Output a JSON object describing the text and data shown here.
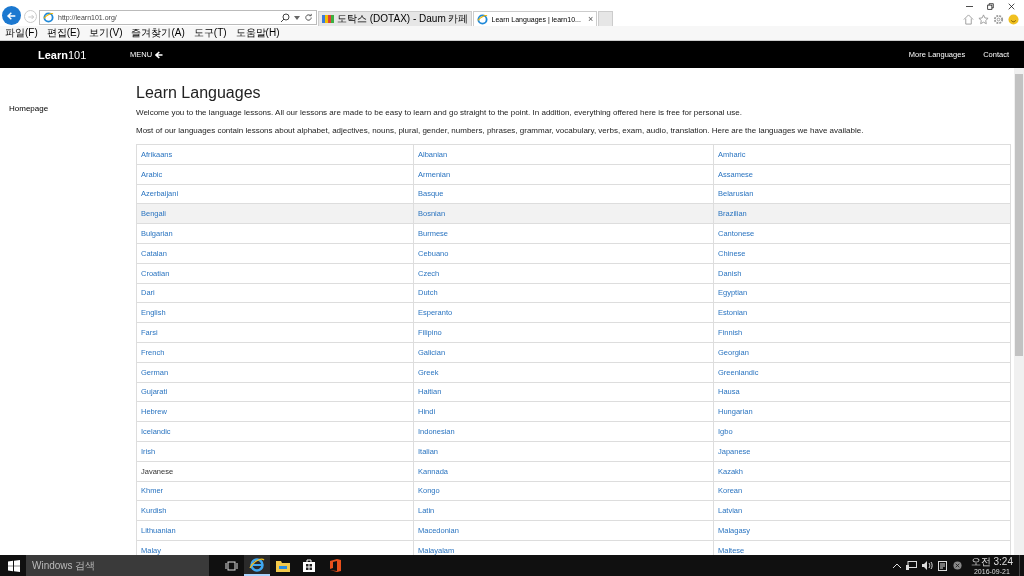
{
  "browser": {
    "url": "http://learn101.org/",
    "tabs": [
      {
        "title": "도탁스 (DOTAX) - Daum 카페",
        "selected": false
      },
      {
        "title": "Learn Languages | learn10...",
        "selected": true,
        "close": "×"
      }
    ],
    "menu": [
      "파일(F)",
      "편집(E)",
      "보기(V)",
      "즐겨찾기(A)",
      "도구(T)",
      "도움말(H)"
    ]
  },
  "header": {
    "logo": "**Learn**101",
    "menu": "MENU",
    "nav": [
      "More Languages",
      "Contact"
    ]
  },
  "sidebar": {
    "items": [
      "Homepage"
    ]
  },
  "page": {
    "title": "Learn Languages",
    "paragraphs": [
      "Welcome you to the language lessons. All our lessons are made to be easy to learn and go straight to the point. In addition, everything offered here is free for personal use.",
      "Most of our languages contain lessons about alphabet, adjectives, nouns, plural, gender, numbers, phrases, grammar, vocabulary, verbs, exam, audio, translation. Here are the languages we have available."
    ]
  },
  "table": {
    "rows": [
      {
        "highlighted": false,
        "cells": [
          {
            "text": "Afrikaans",
            "link": true
          },
          {
            "text": "Albanian",
            "link": true
          },
          {
            "text": "Amharic",
            "link": true
          }
        ]
      },
      {
        "highlighted": false,
        "cells": [
          {
            "text": "Arabic",
            "link": true
          },
          {
            "text": "Armenian",
            "link": true
          },
          {
            "text": "Assamese",
            "link": true
          }
        ]
      },
      {
        "highlighted": false,
        "cells": [
          {
            "text": "Azerbaijani",
            "link": true
          },
          {
            "text": "Basque",
            "link": true
          },
          {
            "text": "Belarusian",
            "link": true
          }
        ]
      },
      {
        "highlighted": true,
        "cells": [
          {
            "text": "Bengali",
            "link": true
          },
          {
            "text": "Bosnian",
            "link": true
          },
          {
            "text": "Brazilian",
            "link": true
          }
        ]
      },
      {
        "highlighted": false,
        "cells": [
          {
            "text": "Bulgarian",
            "link": true
          },
          {
            "text": "Burmese",
            "link": true
          },
          {
            "text": "Cantonese",
            "link": true
          }
        ]
      },
      {
        "highlighted": false,
        "cells": [
          {
            "text": "Catalan",
            "link": true
          },
          {
            "text": "Cebuano",
            "link": true
          },
          {
            "text": "Chinese",
            "link": true
          }
        ]
      },
      {
        "highlighted": false,
        "cells": [
          {
            "text": "Croatian",
            "link": true
          },
          {
            "text": "Czech",
            "link": true
          },
          {
            "text": "Danish",
            "link": true
          }
        ]
      },
      {
        "highlighted": false,
        "cells": [
          {
            "text": "Dari",
            "link": true
          },
          {
            "text": "Dutch",
            "link": true
          },
          {
            "text": "Egyptian",
            "link": true
          }
        ]
      },
      {
        "highlighted": false,
        "cells": [
          {
            "text": "English",
            "link": true
          },
          {
            "text": "Esperanto",
            "link": true
          },
          {
            "text": "Estonian",
            "link": true
          }
        ]
      },
      {
        "highlighted": false,
        "cells": [
          {
            "text": "Farsi",
            "link": true
          },
          {
            "text": "Filipino",
            "link": true
          },
          {
            "text": "Finnish",
            "link": true
          }
        ]
      },
      {
        "highlighted": false,
        "cells": [
          {
            "text": "French",
            "link": true
          },
          {
            "text": "Galician",
            "link": true
          },
          {
            "text": "Georgian",
            "link": true
          }
        ]
      },
      {
        "highlighted": false,
        "cells": [
          {
            "text": "German",
            "link": true
          },
          {
            "text": "Greek",
            "link": true
          },
          {
            "text": "Greenlandic",
            "link": true
          }
        ]
      },
      {
        "highlighted": false,
        "cells": [
          {
            "text": "Gujarati",
            "link": true
          },
          {
            "text": "Haitian",
            "link": true
          },
          {
            "text": "Hausa",
            "link": true
          }
        ]
      },
      {
        "highlighted": false,
        "cells": [
          {
            "text": "Hebrew",
            "link": true
          },
          {
            "text": "Hindi",
            "link": true
          },
          {
            "text": "Hungarian",
            "link": true
          }
        ]
      },
      {
        "highlighted": false,
        "cells": [
          {
            "text": "Icelandic",
            "link": true
          },
          {
            "text": "Indonesian",
            "link": true
          },
          {
            "text": "Igbo",
            "link": true
          }
        ]
      },
      {
        "highlighted": false,
        "cells": [
          {
            "text": "Irish",
            "link": true
          },
          {
            "text": "Italian",
            "link": true
          },
          {
            "text": "Japanese",
            "link": true
          }
        ]
      },
      {
        "highlighted": false,
        "cells": [
          {
            "text": "Javanese",
            "link": false
          },
          {
            "text": "Kannada",
            "link": true
          },
          {
            "text": "Kazakh",
            "link": true
          }
        ]
      },
      {
        "highlighted": false,
        "cells": [
          {
            "text": "Khmer",
            "link": true
          },
          {
            "text": "Kongo",
            "link": true
          },
          {
            "text": "Korean",
            "link": true
          }
        ]
      },
      {
        "highlighted": false,
        "cells": [
          {
            "text": "Kurdish",
            "link": true
          },
          {
            "text": "Latin",
            "link": true
          },
          {
            "text": "Latvian",
            "link": true
          }
        ]
      },
      {
        "highlighted": false,
        "cells": [
          {
            "text": "Lithuanian",
            "link": true
          },
          {
            "text": "Macedonian",
            "link": true
          },
          {
            "text": "Malagasy",
            "link": true
          }
        ]
      },
      {
        "highlighted": false,
        "cells": [
          {
            "text": "Malay",
            "link": true
          },
          {
            "text": "Malayalam",
            "link": true
          },
          {
            "text": "Maltese",
            "link": true
          }
        ]
      }
    ]
  },
  "taskbar": {
    "search_placeholder": "Windows 검색",
    "time": "오전 3:24",
    "date": "2016-09-21"
  }
}
